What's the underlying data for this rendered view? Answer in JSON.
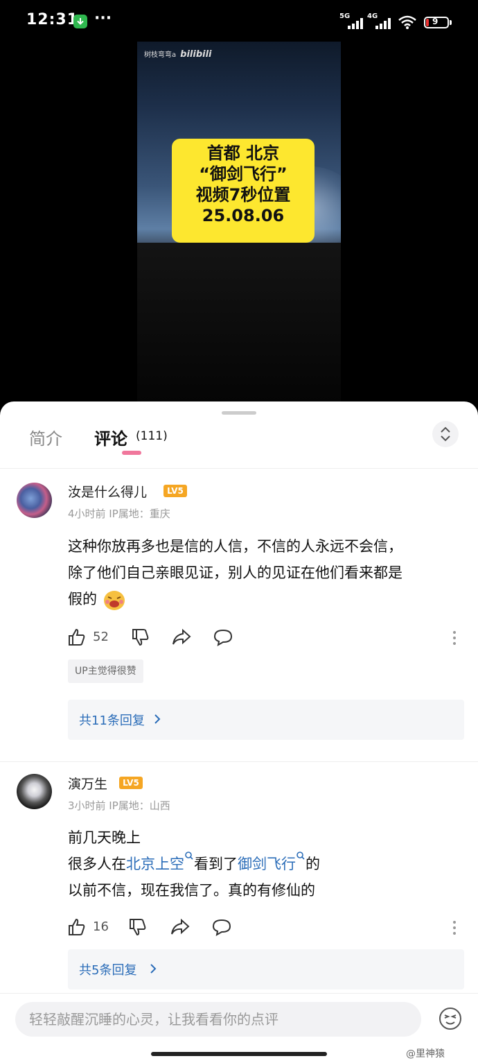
{
  "status_bar": {
    "time": "12:31",
    "more": "···",
    "signal1_label": "5G",
    "signal2_label": "4G",
    "battery_level": "9"
  },
  "video": {
    "uploader": "树枝弯弯a",
    "platform": "bilibili",
    "overlay_lines": [
      "首都  北京",
      "“御剑飞行”",
      "视频7秒位置",
      "25.08.06"
    ]
  },
  "tabs": {
    "intro": "简介",
    "comments": "评论",
    "comments_count": "(111)"
  },
  "comments": [
    {
      "username": "汝是什么得儿",
      "level": "LV5",
      "meta": "4小时前 IP属地：重庆",
      "lines": [
        "这种你放再多也是信的人信，不信的人永远不会信，",
        "除了他们自己亲眼见证，别人的见证在他们看来都是",
        "假的"
      ],
      "likes": "52",
      "up_badge": "UP主觉得很赞",
      "replies": "共11条回复"
    },
    {
      "username": "演万生",
      "level": "LV5",
      "meta": "3小时前 IP属地：山西",
      "line1": "前几天晚上",
      "line2_pre": "很多人在",
      "line2_link1": "北京上空",
      "line2_mid": "看到了",
      "line2_link2": "御剑飞行",
      "line2_post": "的",
      "line3": "以前不信，现在我信了。真的有修仙的",
      "likes": "16",
      "replies": "共5条回复"
    }
  ],
  "input": {
    "placeholder": "轻轻敲醒沉睡的心灵，让我看看你的点评"
  },
  "watermark": "@里神猿",
  "colors": {
    "accent_pink": "#f0779c",
    "link_blue": "#2a6cb8",
    "level_orange": "#f5a623",
    "overlay_yellow": "#fde72f"
  }
}
